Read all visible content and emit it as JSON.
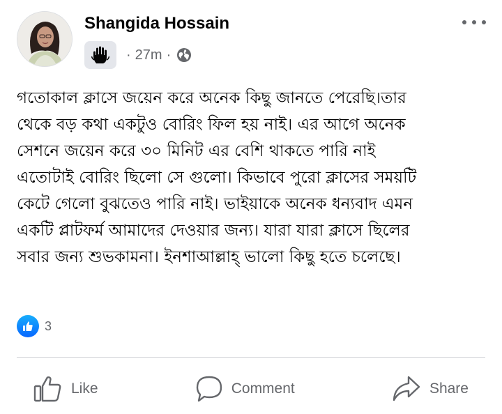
{
  "post": {
    "author": "Shangida Hossain",
    "time": "27m",
    "separator": "·",
    "text_lines": [
      "গতোকাল ক্লাসে জয়েন করে অনেক কিছু জানতে পেরেছি।তার",
      "থেকে বড় কথা একটুও বোরিং ফিল হয় নাই। এর আগে অনেক",
      "সেশনে জয়েন করে ৩০ মিনিট এর বেশি থাকতে পারি নাই",
      "এতোটাই বোরিং ছিলো সে গুলো। কিভাবে পুরো ক্লাসের সময়টি",
      "কেটে গেলো বুঝতেও পারি নাই। ভাইয়াকে অনেক ধন্যবাদ এমন",
      "একটি প্লাটফর্ম আমাদের দেওয়ার জন্য। যারা যারা ক্লাসে ছিলের",
      "সবার জন্য শুভকামনা। ইনশাআল্লাহ্‌ ভালো কিছু হতে চলেছে।"
    ],
    "reaction_count": "3"
  },
  "actions": {
    "like": "Like",
    "comment": "Comment",
    "share": "Share"
  },
  "icons": {
    "more": "more-horizontal-icon",
    "badge": "raised-hand-icon",
    "privacy": "globe-icon",
    "reaction": "thumbs-up-icon",
    "like": "thumbs-up-outline-icon",
    "comment": "speech-bubble-icon",
    "share": "share-arrow-icon"
  },
  "colors": {
    "secondary_text": "#65676b",
    "like_blue": "#0866ff",
    "badge_bg": "#e4e6eb",
    "divider": "#ced0d4"
  }
}
